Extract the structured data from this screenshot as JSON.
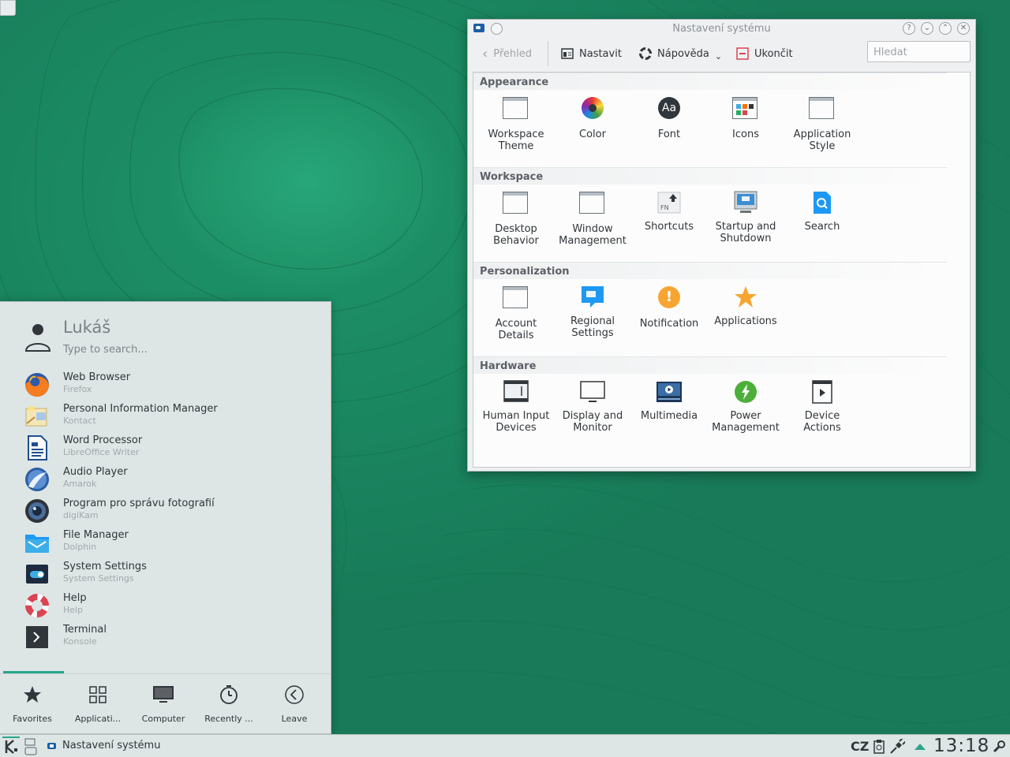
{
  "settings_window": {
    "title": "Nastavení systému",
    "toolbar": {
      "back_label": "Přehled",
      "configure_label": "Nastavit",
      "help_label": "Nápověda",
      "quit_label": "Ukončit",
      "search_placeholder": "Hledat"
    },
    "sections": [
      {
        "title": "Appearance",
        "items": [
          {
            "label": "Workspace Theme",
            "icon": "window-icon"
          },
          {
            "label": "Color",
            "icon": "color-wheel-icon"
          },
          {
            "label": "Font",
            "icon": "font-icon"
          },
          {
            "label": "Icons",
            "icon": "icons-icon"
          },
          {
            "label": "Application Style",
            "icon": "window-icon"
          }
        ]
      },
      {
        "title": "Workspace",
        "items": [
          {
            "label": "Desktop Behavior",
            "icon": "window-icon"
          },
          {
            "label": "Window Management",
            "icon": "window-icon"
          },
          {
            "label": "Shortcuts",
            "icon": "keyboard-fn-icon"
          },
          {
            "label": "Startup and Shutdown",
            "icon": "monitor-blue-icon"
          },
          {
            "label": "Search",
            "icon": "search-document-icon"
          }
        ]
      },
      {
        "title": "Personalization",
        "items": [
          {
            "label": "Account Details",
            "icon": "window-icon"
          },
          {
            "label": "Regional Settings",
            "icon": "speech-bubble-icon"
          },
          {
            "label": "Notification",
            "icon": "exclamation-icon"
          },
          {
            "label": "Applications",
            "icon": "star-icon"
          }
        ]
      },
      {
        "title": "Hardware",
        "items": [
          {
            "label": "Human Input Devices",
            "icon": "input-devices-icon"
          },
          {
            "label": "Display and Monitor",
            "icon": "monitor-icon"
          },
          {
            "label": "Multimedia",
            "icon": "multimedia-icon"
          },
          {
            "label": "Power Management",
            "icon": "power-icon"
          },
          {
            "label": "Device Actions",
            "icon": "device-actions-icon"
          }
        ]
      }
    ]
  },
  "launcher": {
    "user_name": "Lukáš",
    "search_placeholder": "Type to search...",
    "favorites": [
      {
        "name": "Web Browser",
        "app": "Firefox",
        "icon": "firefox-icon"
      },
      {
        "name": "Personal Information Manager",
        "app": "Kontact",
        "icon": "kontact-icon"
      },
      {
        "name": "Word Processor",
        "app": "LibreOffice Writer",
        "icon": "writer-icon"
      },
      {
        "name": "Audio Player",
        "app": "Amarok",
        "icon": "amarok-icon"
      },
      {
        "name": "Program pro správu fotografií",
        "app": "digiKam",
        "icon": "digikam-icon"
      },
      {
        "name": "File Manager",
        "app": "Dolphin",
        "icon": "dolphin-icon"
      },
      {
        "name": "System Settings",
        "app": "System Settings",
        "icon": "system-settings-icon"
      },
      {
        "name": "Help",
        "app": "Help",
        "icon": "help-lifebuoy-icon"
      },
      {
        "name": "Terminal",
        "app": "Konsole",
        "icon": "terminal-icon"
      }
    ],
    "tabs": [
      {
        "label": "Favorites",
        "icon": "star-icon"
      },
      {
        "label": "Applicati...",
        "icon": "grid-icon"
      },
      {
        "label": "Computer",
        "icon": "computer-icon"
      },
      {
        "label": "Recently ...",
        "icon": "clock-icon"
      },
      {
        "label": "Leave",
        "icon": "arrow-left-circle-icon"
      }
    ]
  },
  "taskbar": {
    "task_label": "Nastavení systému",
    "keyboard_layout": "CZ",
    "clock": "13:18"
  }
}
